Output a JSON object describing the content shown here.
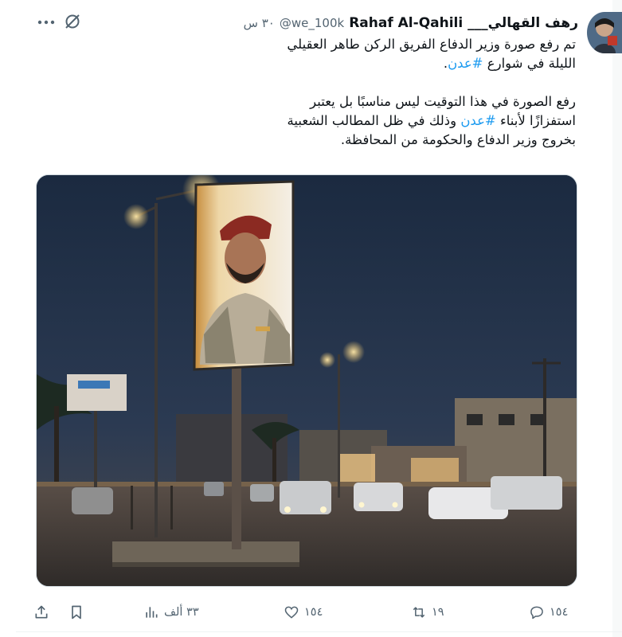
{
  "tweet": {
    "display_name": "Rahaf Al-Qahili ___رهف القهالي",
    "handle": "@we_100k",
    "time": "٣٠ س",
    "paragraph1_before": "تم رفع صورة وزير الدفاع الفريق الركن طاهر العقيلي\nالليلة في شوارع ",
    "paragraph1_hashtag": "#عدن",
    "paragraph1_after": ".",
    "paragraph2_before": "رفع الصورة في هذا التوقيت ليس مناسبًا بل يعتبر\nاستفزازًا لأبناء ",
    "paragraph2_hashtag": "#عدن",
    "paragraph2_after": " وذلك في ظل المطالب الشعبية\nبخروج وزير الدفاع والحكومة من المحافظة."
  },
  "actions": {
    "replies": "١٥٤",
    "reposts": "١٩",
    "likes": "١٥٤",
    "views": "٣٣ ألف"
  },
  "icons": {
    "more": "more-dots-icon",
    "grok": "grok-icon",
    "reply": "reply-icon",
    "repost": "repost-icon",
    "like": "heart-icon",
    "views": "views-chart-icon",
    "bookmark": "bookmark-icon",
    "share": "share-icon"
  },
  "colors": {
    "accent": "#1d9bf0",
    "text": "#0f1419",
    "secondary": "#536471"
  }
}
